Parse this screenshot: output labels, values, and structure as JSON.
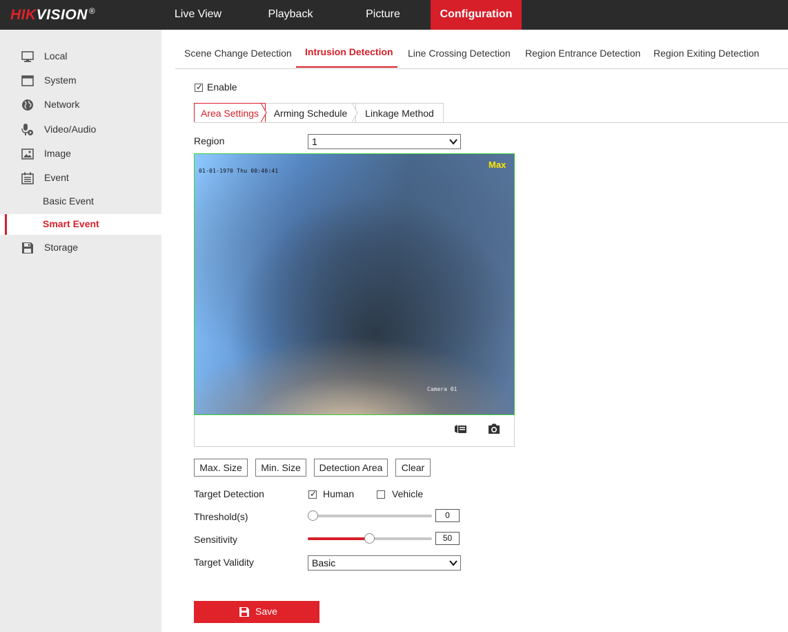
{
  "header": {
    "logo_brand": "HIKVISION",
    "logo_mark": "®",
    "nav": [
      {
        "label": "Live View"
      },
      {
        "label": "Playback"
      },
      {
        "label": "Picture"
      },
      {
        "label": "Configuration",
        "active": true
      }
    ]
  },
  "sidebar": {
    "items": [
      {
        "label": "Local",
        "icon": "monitor-icon"
      },
      {
        "label": "System",
        "icon": "window-icon"
      },
      {
        "label": "Network",
        "icon": "globe-icon"
      },
      {
        "label": "Video/Audio",
        "icon": "microphone-icon"
      },
      {
        "label": "Image",
        "icon": "image-icon"
      },
      {
        "label": "Event",
        "icon": "calendar-icon"
      },
      {
        "label": "Storage",
        "icon": "floppy-disk-icon"
      }
    ],
    "event_subitems": [
      {
        "label": "Basic Event"
      },
      {
        "label": "Smart Event",
        "active": true
      }
    ]
  },
  "tabs": [
    {
      "label": "Scene Change Detection"
    },
    {
      "label": "Intrusion Detection",
      "active": true
    },
    {
      "label": "Line Crossing Detection"
    },
    {
      "label": "Region Entrance Detection"
    },
    {
      "label": "Region Exiting Detection"
    }
  ],
  "enable": {
    "label": "Enable",
    "checked": true
  },
  "subtabs": [
    {
      "label": "Area Settings",
      "active": true
    },
    {
      "label": "Arming Schedule"
    },
    {
      "label": "Linkage Method"
    }
  ],
  "region": {
    "label": "Region",
    "value": "1"
  },
  "video": {
    "osd_time": "01-01-1970 Thu 00:40:41",
    "osd_max": "Max",
    "osd_camera": "Camera 01"
  },
  "buttons": [
    {
      "label": "Max. Size"
    },
    {
      "label": "Min. Size"
    },
    {
      "label": "Detection Area"
    },
    {
      "label": "Clear"
    }
  ],
  "target_detection": {
    "label": "Target Detection",
    "human": {
      "label": "Human",
      "checked": true
    },
    "vehicle": {
      "label": "Vehicle",
      "checked": false
    }
  },
  "threshold": {
    "label": "Threshold(s)",
    "value": "0",
    "fraction": 0
  },
  "sensitivity": {
    "label": "Sensitivity",
    "value": "50",
    "fraction": 0.5
  },
  "target_validity": {
    "label": "Target Validity",
    "value": "Basic"
  },
  "save": {
    "label": "Save"
  },
  "colors": {
    "accent": "#d71f29",
    "topbar": "#2b2b2b",
    "sidebar": "#ebebeb"
  }
}
